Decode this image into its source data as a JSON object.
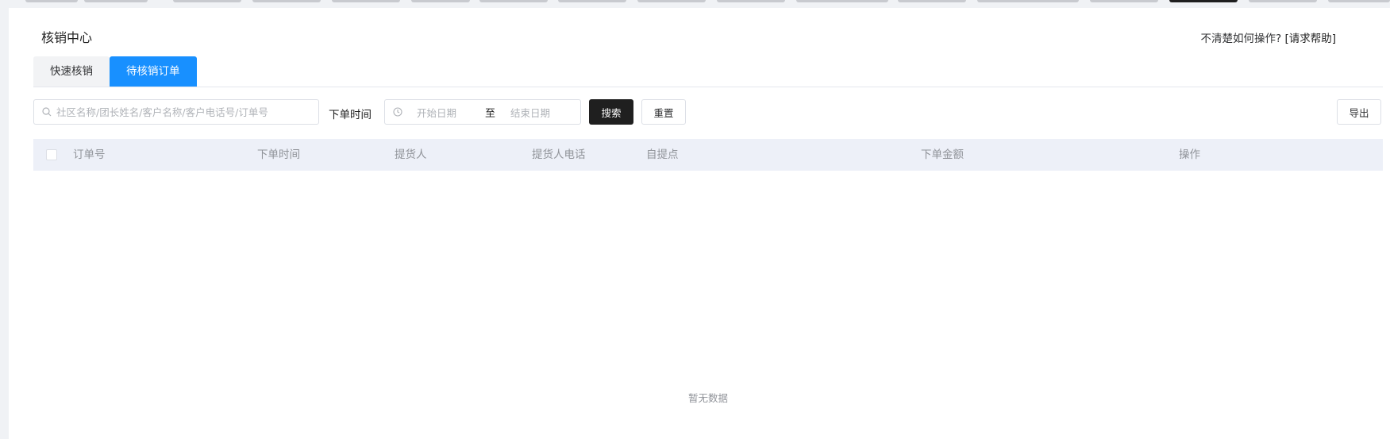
{
  "header": {
    "title": "核销中心",
    "help_prefix": "不清楚如何操作?",
    "help_link": "[请求帮助]"
  },
  "tabs": [
    {
      "label": "快速核销",
      "active": false
    },
    {
      "label": "待核销订单",
      "active": true
    }
  ],
  "filters": {
    "search_placeholder": "社区名称/团长姓名/客户名称/客户电话号/订单号",
    "search_value": "",
    "time_label": "下单时间",
    "start_placeholder": "开始日期",
    "separator": "至",
    "end_placeholder": "结束日期",
    "search_button": "搜索",
    "reset_button": "重置",
    "export_button": "导出"
  },
  "table": {
    "columns": [
      "订单号",
      "下单时间",
      "提货人",
      "提货人电话",
      "自提点",
      "下单金额",
      "操作"
    ],
    "rows": [],
    "empty_text": "暂无数据"
  },
  "colors": {
    "accent": "#1890ff",
    "primary_dark": "#1f1f1f",
    "header_bg": "#edf0f8"
  }
}
